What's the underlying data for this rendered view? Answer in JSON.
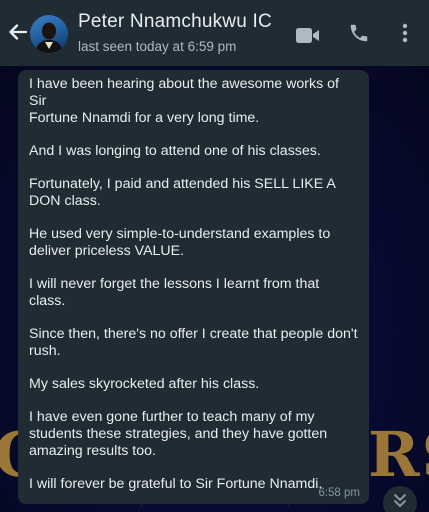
{
  "header": {
    "contact_name": "Peter Nnamchukwu IC",
    "last_seen": "last seen today at 6:59 pm",
    "icons": [
      "back-arrow-icon",
      "video-call-icon",
      "phone-icon",
      "more-vertical-icon"
    ]
  },
  "message": {
    "paragraphs": [
      [
        "I have been hearing about the awesome works of Sir",
        "Fortune Nnamdi for a very long time."
      ],
      [
        "And I was longing to attend one of his classes."
      ],
      [
        "Fortunately, I paid and attended his SELL LIKE A",
        "DON class."
      ],
      [
        "He used very simple-to-understand examples to",
        "deliver priceless VALUE."
      ],
      [
        "I will never forget the lessons I learnt from that",
        "class."
      ],
      [
        "Since then, there's no offer I create that people don't",
        "rush."
      ],
      [
        "My sales skyrocketed after his class."
      ],
      [
        "I have even gone further to teach many of my",
        "students these strategies, and they have gotten",
        "amazing results too."
      ],
      [
        "I will forever be grateful to Sir Fortune Nnamdi."
      ]
    ],
    "time": "6:58 pm"
  },
  "wallpaper": {
    "left_text": "C",
    "right_text": "RS"
  },
  "colors": {
    "header_bg": "#1f2c33",
    "bubble_bg": "#1f2c33",
    "wallpaper_bg": "#070a2e",
    "text_primary": "#e9edef",
    "text_secondary": "#aebac1",
    "gold": "#b48a3a"
  }
}
